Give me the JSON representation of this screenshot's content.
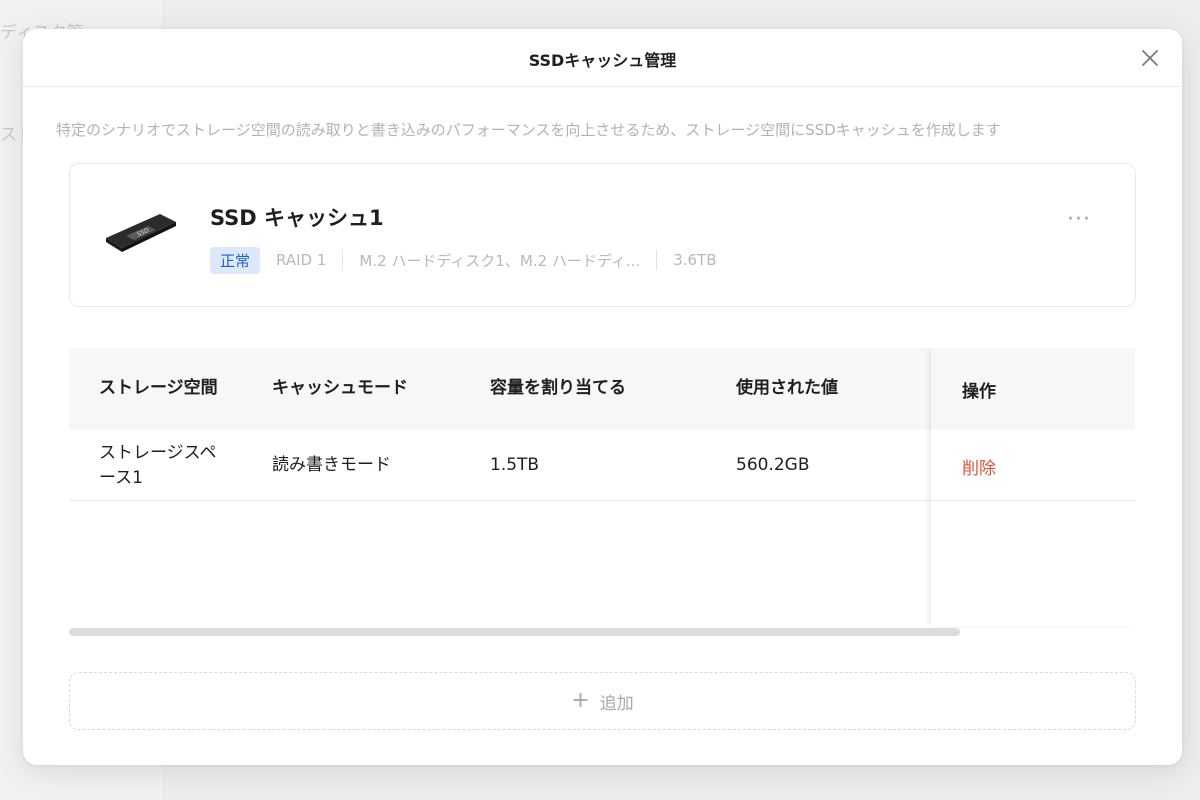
{
  "background": {
    "partial_text_top": "ディスク管",
    "partial_text_mid": "スト"
  },
  "modal": {
    "title": "SSDキャッシュ管理",
    "description": "特定のシナリオでストレージ空間の読み取りと書き込みのパフォーマンスを向上させるため、ストレージ空間にSSDキャッシュを作成します"
  },
  "cache": {
    "name": "SSD キャッシュ1",
    "status": "正常",
    "raid": "RAID 1",
    "disks": "M.2 ハードディスク1、M.2 ハードディ...",
    "capacity": "3.6TB",
    "ssd_label": "SSD"
  },
  "table": {
    "headers": {
      "storage": "ストレージ空間",
      "mode": "キャッシュモード",
      "allocated": "容量を割り当てる",
      "used": "使用された値",
      "ops": "操作"
    },
    "rows": [
      {
        "storage": "ストレージスペース1",
        "mode": "読み書きモード",
        "allocated": "1.5TB",
        "used": "560.2GB",
        "action": "削除"
      }
    ]
  },
  "add_button": {
    "label": "追加"
  },
  "colors": {
    "status_bg": "#dde9fb",
    "status_text": "#1e5fd6",
    "delete": "#e0533c"
  }
}
